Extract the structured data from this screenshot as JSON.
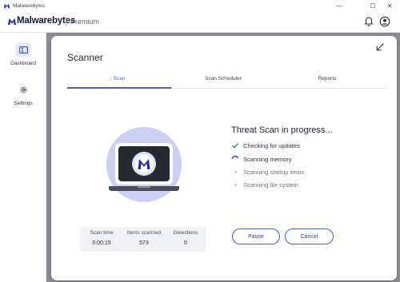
{
  "window": {
    "title": "Malwarebytes",
    "controls": {
      "minimize": "—",
      "maximize": "☐",
      "close": "✕"
    }
  },
  "header": {
    "brand": "Malwarebytes",
    "edition": "Premium",
    "icons": [
      "bell-icon",
      "account-icon"
    ]
  },
  "sidebar": {
    "items": [
      {
        "label": "Dashboard",
        "icon": "dashboard-icon",
        "selected": true
      },
      {
        "label": "Settings",
        "icon": "gear-icon",
        "selected": false
      }
    ]
  },
  "scanner": {
    "title": "Scanner",
    "tabs": [
      {
        "label": "Scan",
        "active": true
      },
      {
        "label": "Scan Scheduler",
        "active": false
      },
      {
        "label": "Reports",
        "active": false
      }
    ],
    "status_title": "Threat Scan in progress...",
    "steps": [
      {
        "label": "Checking for updates",
        "state": "done"
      },
      {
        "label": "Scanning memory",
        "state": "in-progress"
      },
      {
        "label": "Scanning startup items",
        "state": "pending"
      },
      {
        "label": "Scanning file system",
        "state": "pending"
      }
    ],
    "stats": {
      "scan_time_label": "Scan time",
      "scan_time": "0:00:15",
      "items_label": "Items scanned",
      "items": "573",
      "detections_label": "Detections",
      "detections": "0"
    },
    "pause_label": "Pause",
    "cancel_label": "Cancel"
  },
  "colors": {
    "accent": "#4a5fd0",
    "brand_dark": "#0b1a3e",
    "illustration_bg": "#c9d0f2"
  }
}
